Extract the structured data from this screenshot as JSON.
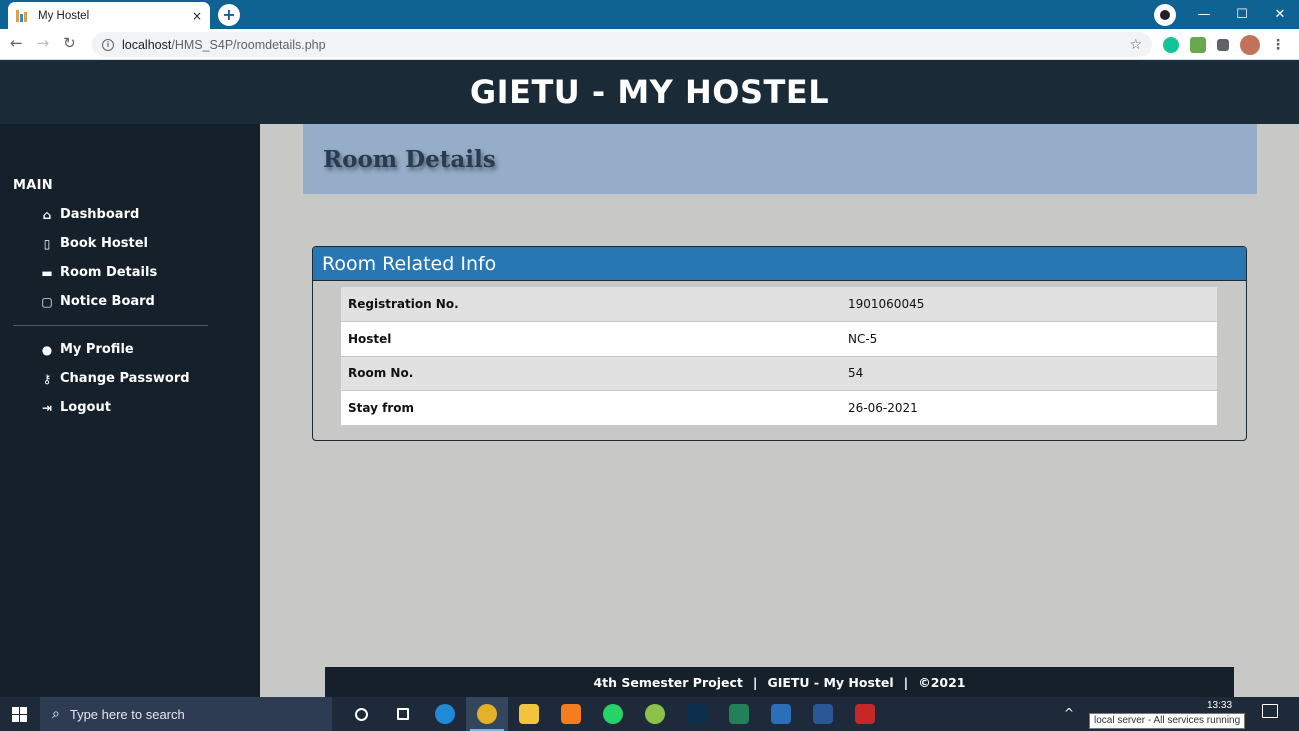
{
  "browser": {
    "tab_title": "My Hostel",
    "tab_close": "×",
    "new_tab": "+",
    "url_host": "localhost",
    "url_path": "/HMS_S4P/roomdetails.php",
    "window_controls": [
      "—",
      "☐",
      "✕"
    ]
  },
  "header": {
    "title": "GIETU - MY HOSTEL"
  },
  "sidebar": {
    "heading": "MAIN",
    "main_items": [
      {
        "label": "Dashboard",
        "icon": "dashboard-icon"
      },
      {
        "label": "Book Hostel",
        "icon": "file-icon"
      },
      {
        "label": "Room Details",
        "icon": "bed-icon"
      },
      {
        "label": "Notice Board",
        "icon": "clipboard-icon"
      }
    ],
    "account_items": [
      {
        "label": "My Profile",
        "icon": "user-circle-icon"
      },
      {
        "label": "Change Password",
        "icon": "key-icon"
      },
      {
        "label": "Logout",
        "icon": "logout-icon"
      }
    ]
  },
  "page": {
    "title": "Room Details"
  },
  "panel": {
    "heading": "Room Related Info",
    "rows": [
      {
        "label": "Registration No.",
        "value": "1901060045"
      },
      {
        "label": "Hostel",
        "value": "NC-5"
      },
      {
        "label": "Room No.",
        "value": "54"
      },
      {
        "label": "Stay from",
        "value": "26-06-2021"
      }
    ]
  },
  "footer": {
    "project": "4th Semester Project",
    "site": "GIETU - My Hostel",
    "copyright": "©2021",
    "separator": "|"
  },
  "taskbar": {
    "search_placeholder": "Type here to search",
    "tooltip": "local server - All services running",
    "time": "13:33",
    "apps": [
      {
        "name": "cortana-icon",
        "color": "#1e2a3a"
      },
      {
        "name": "task-view-icon",
        "color": "#1e2a3a"
      },
      {
        "name": "edge-icon",
        "color": "#1f8ad6"
      },
      {
        "name": "chrome-icon",
        "color": "#e4b22a"
      },
      {
        "name": "file-explorer-icon",
        "color": "#f1c33e"
      },
      {
        "name": "sublime-icon",
        "color": "#f57c1f"
      },
      {
        "name": "whatsapp-icon",
        "color": "#25d366"
      },
      {
        "name": "picasa-icon",
        "color": "#8bc34a"
      },
      {
        "name": "photoshop-icon",
        "color": "#0b2f4d"
      },
      {
        "name": "app-green-icon",
        "color": "#22805a"
      },
      {
        "name": "app-blue-icon",
        "color": "#2a6fb8"
      },
      {
        "name": "word-icon",
        "color": "#2b5797"
      },
      {
        "name": "acrobat-icon",
        "color": "#c62828"
      }
    ]
  },
  "colors": {
    "header_bg": "#1a2a37",
    "sidebar_bg": "#15202a",
    "banner_bg": "#95adc9",
    "panel_head_bg": "#2777b4"
  }
}
